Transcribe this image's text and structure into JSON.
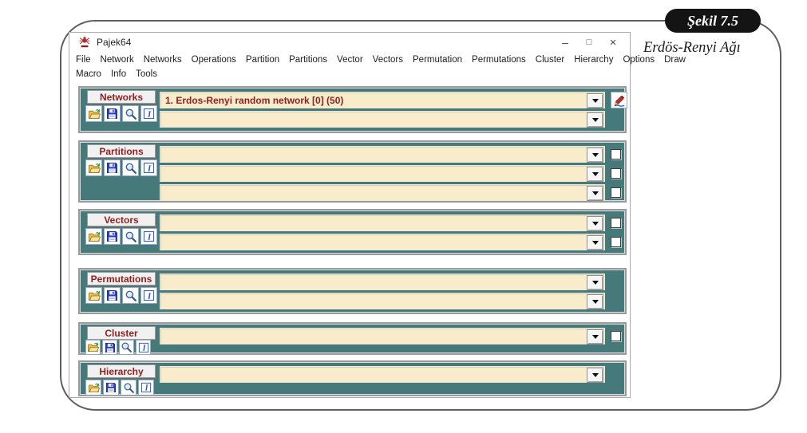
{
  "figure": {
    "tag_label": "Şekil 7.5",
    "caption": "Erdös-Renyi Ağı"
  },
  "titlebar": {
    "title": "Pajek64",
    "minimize_glyph": "–",
    "maximize_glyph": "□",
    "close_glyph": "×"
  },
  "menu": {
    "row1": [
      "File",
      "Network",
      "Networks",
      "Operations",
      "Partition",
      "Partitions",
      "Vector",
      "Vectors",
      "Permutation",
      "Permutations",
      "Cluster",
      "Hierarchy",
      "Options",
      "Draw"
    ],
    "row2": [
      "Macro",
      "Info",
      "Tools"
    ]
  },
  "icons": {
    "logo": "pajek-spider-icon",
    "open": "folder-open-icon",
    "save": "floppy-save-icon",
    "find": "magnifier-icon",
    "info": "info-icon",
    "edit": "pencil-edit-icon",
    "dropdown": "chevron-down-icon"
  },
  "sections": [
    {
      "label": "Networks",
      "rows": [
        {
          "value": "1. Erdos-Renyi random network [0] (50)"
        },
        {
          "value": ""
        }
      ]
    },
    {
      "label": "Partitions",
      "rows": [
        {
          "value": ""
        },
        {
          "value": ""
        },
        {
          "value": ""
        }
      ]
    },
    {
      "label": "Vectors",
      "rows": [
        {
          "value": ""
        },
        {
          "value": ""
        }
      ]
    },
    {
      "label": "Permutations",
      "rows": [
        {
          "value": ""
        },
        {
          "value": ""
        }
      ]
    },
    {
      "label": "Cluster",
      "rows": [
        {
          "value": ""
        }
      ]
    },
    {
      "label": "Hierarchy",
      "rows": [
        {
          "value": ""
        }
      ]
    }
  ],
  "colors": {
    "panel_teal": "#45797A",
    "combo_field_cream": "#F8ECCB",
    "maroon_text": "#8E1F1F",
    "figure_pill_bg": "#141414"
  }
}
